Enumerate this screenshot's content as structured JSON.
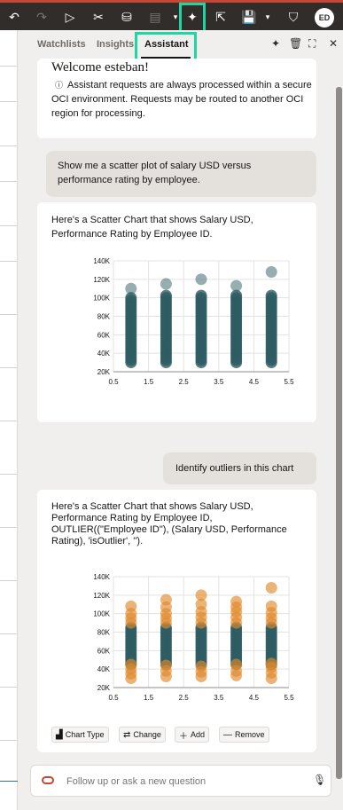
{
  "toolbar": {
    "icons": [
      "undo-icon",
      "redo-icon",
      "play-icon",
      "tools-icon",
      "data-icon",
      "comment-icon",
      "assistant-icon",
      "export-icon",
      "save-icon",
      "bookmark-icon"
    ],
    "avatar_initials": "ED"
  },
  "tabs": {
    "watchlists": "Watchlists",
    "insights": "Insights",
    "assistant": "Assistant",
    "active": "Assistant"
  },
  "welcome": {
    "title": "Welcome esteban!",
    "notice": "Assistant requests are always processed within a secure OCI environment. Requests may be routed to another OCI region for processing."
  },
  "messages": {
    "user1": "Show me a scatter plot of salary USD versus performance rating by employee.",
    "assistant1": "Here's a Scatter Chart that shows Salary USD, Performance Rating by Employee ID.",
    "user2": "Identify outliers in this chart",
    "assistant2": "Here's a Scatter Chart that shows Salary USD, Performance Rating by Employee ID, OUTLIER((\"Employee ID\"), (Salary USD, Performance Rating), 'isOutlier', '')."
  },
  "actions": {
    "chart_type": "Chart Type",
    "change": "Change",
    "add": "Add",
    "remove": "Remove"
  },
  "input": {
    "placeholder": "Follow up or ask a new question"
  },
  "colors": {
    "series": "#2e5c63",
    "outlier": "#e08a2b",
    "topbar": "#312d2a",
    "highlight": "#1dd6a4"
  },
  "chart_data": [
    {
      "type": "scatter",
      "x_ticks": [
        "0.5",
        "1.5",
        "2.5",
        "3.5",
        "4.5",
        "5.5"
      ],
      "y_ticks": [
        "20K",
        "40K",
        "60K",
        "80K",
        "100K",
        "120K",
        "140K"
      ],
      "xlim": [
        0.5,
        5.5
      ],
      "ylim": [
        20000,
        140000
      ],
      "grid": true,
      "series": [
        {
          "x": 1,
          "y_range": [
            30000,
            102000
          ],
          "top_points": [
            110000
          ]
        },
        {
          "x": 2,
          "y_range": [
            30000,
            104000
          ],
          "top_points": [
            115000
          ]
        },
        {
          "x": 3,
          "y_range": [
            30000,
            104000
          ],
          "top_points": [
            120000
          ]
        },
        {
          "x": 4,
          "y_range": [
            30000,
            104000
          ],
          "top_points": [
            113000
          ]
        },
        {
          "x": 5,
          "y_range": [
            30000,
            104000
          ],
          "top_points": [
            128000
          ]
        }
      ]
    },
    {
      "type": "scatter",
      "x_ticks": [
        "0.5",
        "1.5",
        "2.5",
        "3.5",
        "4.5",
        "5.5"
      ],
      "y_ticks": [
        "20K",
        "40K",
        "60K",
        "80K",
        "100K",
        "120K",
        "140K"
      ],
      "xlim": [
        0.5,
        5.5
      ],
      "ylim": [
        20000,
        140000
      ],
      "grid": true,
      "series": [
        {
          "x": 1,
          "y_range": [
            45000,
            85000
          ],
          "outliers": [
            30000,
            35000,
            40000,
            45000,
            90000,
            95000,
            100000,
            108000
          ]
        },
        {
          "x": 2,
          "y_range": [
            45000,
            85000
          ],
          "outliers": [
            32000,
            38000,
            44000,
            90000,
            95000,
            100000,
            107000,
            115000
          ]
        },
        {
          "x": 3,
          "y_range": [
            45000,
            85000
          ],
          "outliers": [
            32000,
            37000,
            43000,
            90000,
            96000,
            102000,
            110000,
            120000
          ]
        },
        {
          "x": 4,
          "y_range": [
            45000,
            85000
          ],
          "outliers": [
            33000,
            38000,
            45000,
            90000,
            96000,
            102000,
            107000,
            113000
          ]
        },
        {
          "x": 5,
          "y_range": [
            45000,
            85000
          ],
          "outliers": [
            30000,
            36000,
            42000,
            46000,
            90000,
            95000,
            101000,
            108000,
            128000
          ]
        }
      ]
    }
  ]
}
